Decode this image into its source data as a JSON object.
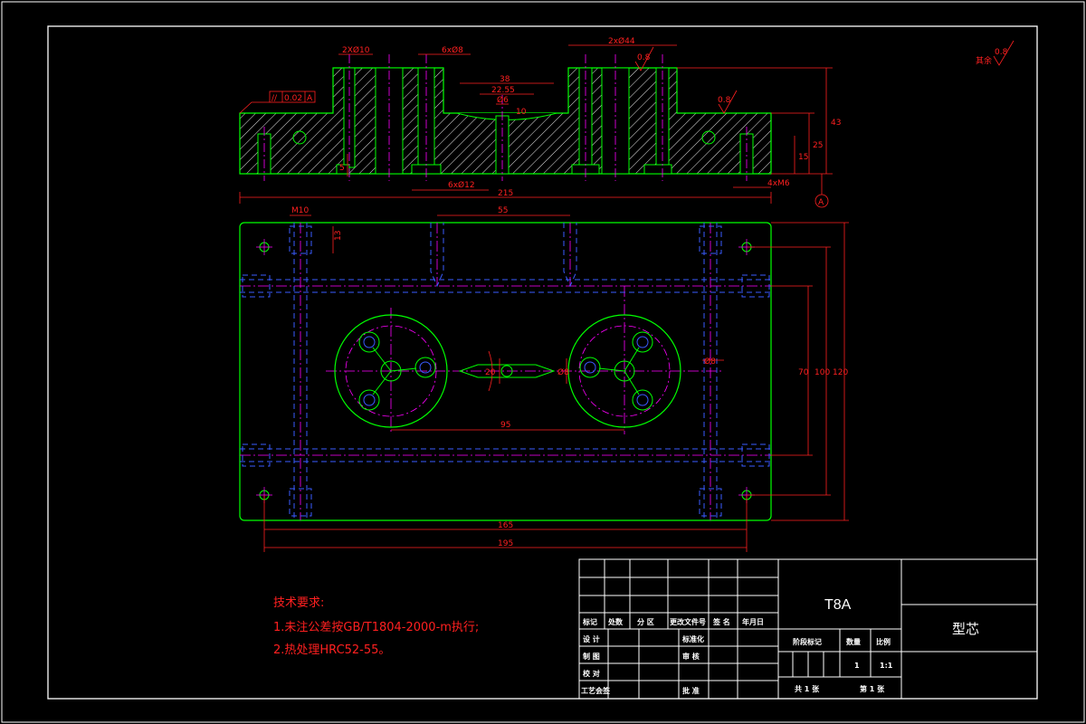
{
  "colors": {
    "background": "#000000",
    "frame": "#ffffff",
    "outline": "#00ff00",
    "hidden": "#3a5bff",
    "center": "#ff00ff",
    "dimension": "#ff2020",
    "text": "#ffffff"
  },
  "dimensions": {
    "holes_10": "2XØ10",
    "holes_8": "6xØ8",
    "holes_44": "2xØ44",
    "d38": "38",
    "d22_55": "22.55",
    "d6": "Ø6",
    "d10_small": "10",
    "holes_12": "6xØ12",
    "d215": "215",
    "d55": "55",
    "m10": "M10",
    "d13": "13",
    "d20": "20",
    "d95": "95",
    "d70": "70",
    "d100": "100",
    "d120": "120",
    "d165": "165",
    "d195": "195",
    "d43": "43",
    "d25": "25",
    "d15": "15",
    "d5": "5",
    "m6": "4xM6",
    "d8a": "Ø8",
    "d8b": "Ø8",
    "d8c": "Ø8",
    "tolerance_symbol": "//",
    "tolerance_value": "0.02",
    "datum": "A",
    "datum_circle": "A",
    "roughness_main": "0.8",
    "roughness_a": "0.8",
    "roughness_b": "0.8",
    "roughness_other": "其余"
  },
  "tech_requirements": {
    "title": "技术要求:",
    "line1": "1.未注公差按GB/T1804-2000-m执行;",
    "line2": "2.热处理HRC52-55。"
  },
  "title_block": {
    "material": "T8A",
    "part_name": "型芯",
    "headers": [
      "标记",
      "处数",
      "分 区",
      "更改文件号",
      "签 名",
      "年月日"
    ],
    "row_design": "设 计",
    "row_standard": "标准化",
    "row_draw": "制 图",
    "row_review": "审 核",
    "row_check": "校 对",
    "row_process": "工艺会签",
    "row_approve": "批 准",
    "stage_label": "阶段标记",
    "qty_label": "数量",
    "scale_label": "比例",
    "qty_value": "1",
    "scale_value": "1:1",
    "sheets_total": "共 1 张",
    "sheet_num": "第 1 张"
  }
}
